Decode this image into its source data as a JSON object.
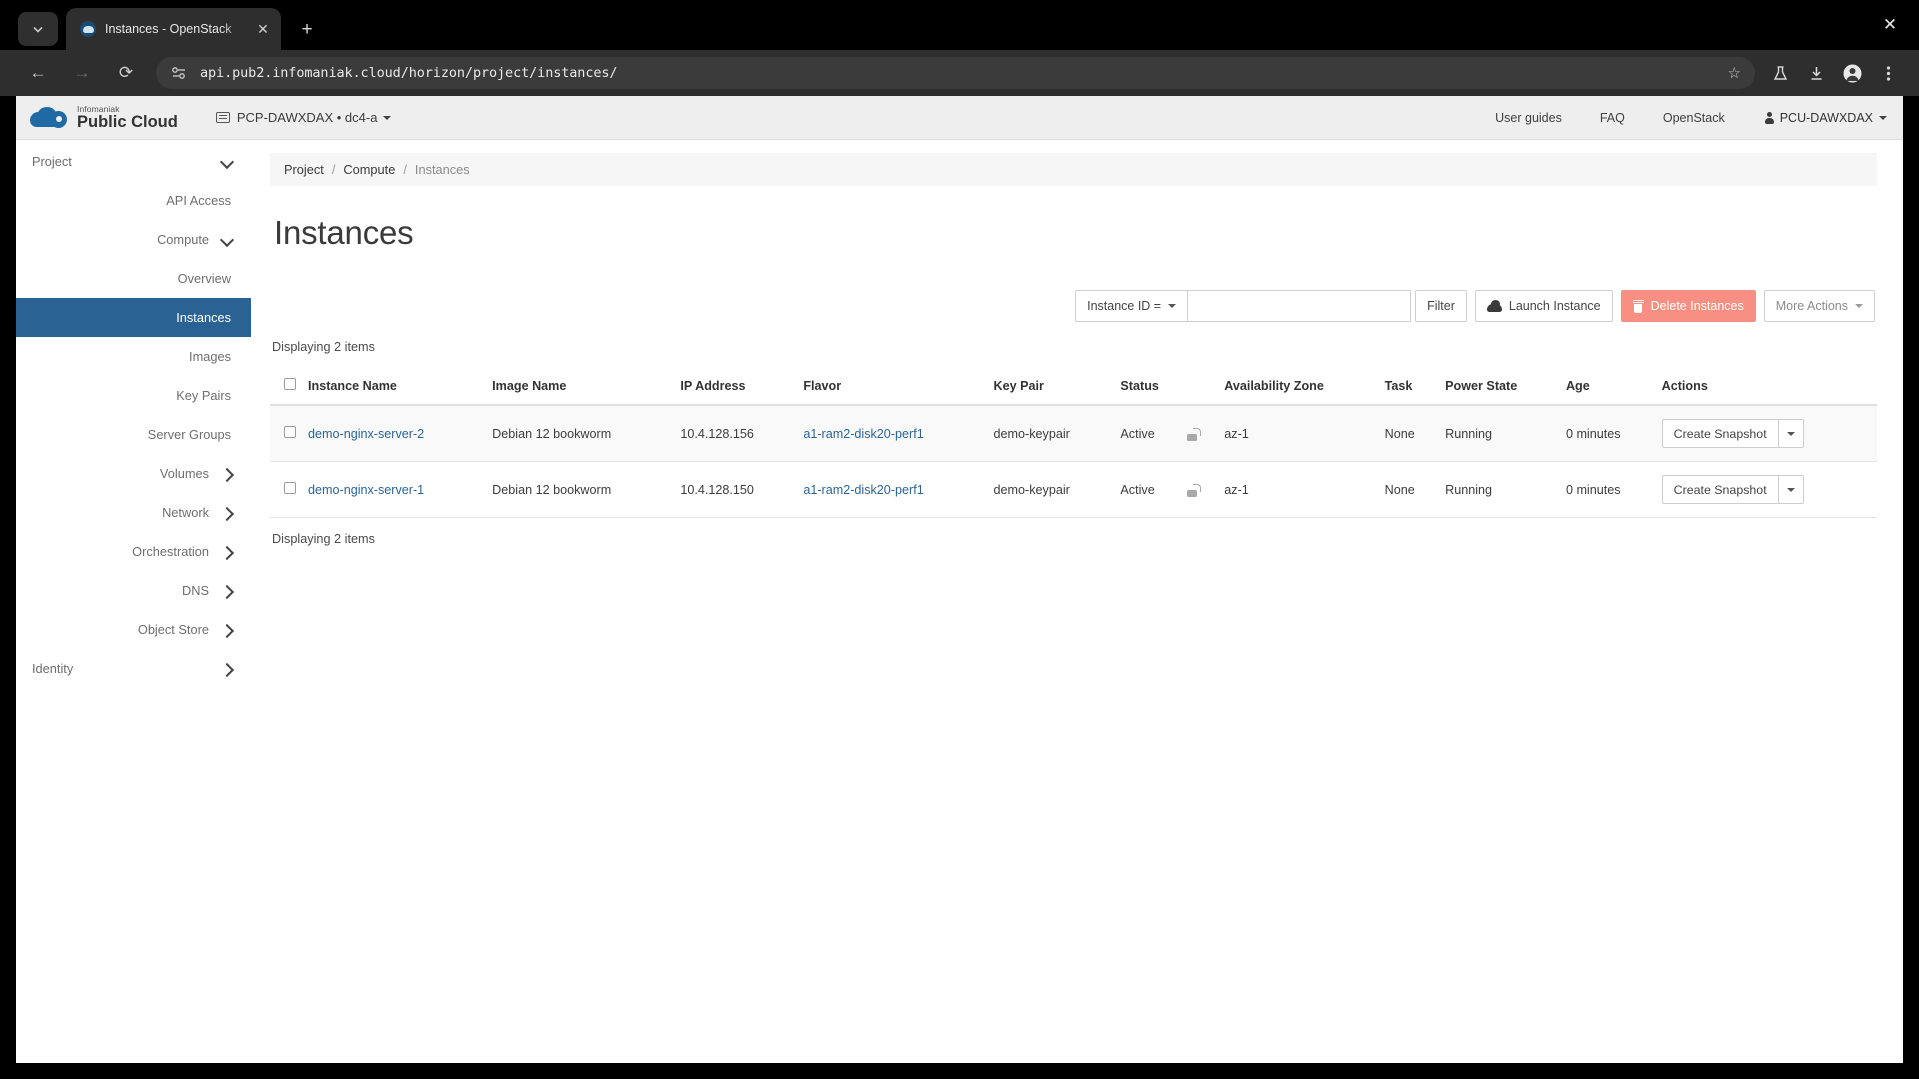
{
  "browser": {
    "tab": {
      "title": "Instances - OpenStack",
      "favicon": "openstack-favicon"
    },
    "new_tab_label": "+",
    "window_close_label": "✕",
    "tab_close_label": "✕",
    "tab_list_label": "⌄",
    "nav": {
      "back": "←",
      "forward": "→",
      "reload": "⟳"
    },
    "url": "api.pub2.infomaniak.cloud/horizon/project/instances/",
    "toolbar_icons": [
      "bookmark-star-icon",
      "experiments-flask-icon",
      "downloads-icon",
      "profile-icon",
      "browser-menu-icon"
    ]
  },
  "header": {
    "brand": {
      "sup": "Infomaniak",
      "main": "Public Cloud"
    },
    "project_switcher": "PCP-DAWXDAX • dc4-a",
    "links": [
      "User guides",
      "FAQ",
      "OpenStack"
    ],
    "user": "PCU-DAWXDAX"
  },
  "sidebar": {
    "items": [
      {
        "label": "Project",
        "level": 0,
        "state": "expanded",
        "active": false
      },
      {
        "label": "API Access",
        "level": 1,
        "state": "leaf",
        "active": false
      },
      {
        "label": "Compute",
        "level": 1,
        "state": "expanded",
        "active": false
      },
      {
        "label": "Overview",
        "level": 2,
        "state": "leaf",
        "active": false
      },
      {
        "label": "Instances",
        "level": 2,
        "state": "leaf",
        "active": true
      },
      {
        "label": "Images",
        "level": 2,
        "state": "leaf",
        "active": false
      },
      {
        "label": "Key Pairs",
        "level": 2,
        "state": "leaf",
        "active": false
      },
      {
        "label": "Server Groups",
        "level": 2,
        "state": "leaf",
        "active": false
      },
      {
        "label": "Volumes",
        "level": 1,
        "state": "collapsed",
        "active": false
      },
      {
        "label": "Network",
        "level": 1,
        "state": "collapsed",
        "active": false
      },
      {
        "label": "Orchestration",
        "level": 1,
        "state": "collapsed",
        "active": false
      },
      {
        "label": "DNS",
        "level": 1,
        "state": "collapsed",
        "active": false
      },
      {
        "label": "Object Store",
        "level": 1,
        "state": "collapsed",
        "active": false
      },
      {
        "label": "Identity",
        "level": 0,
        "state": "collapsed",
        "active": false
      }
    ]
  },
  "breadcrumb": {
    "items": [
      "Project",
      "Compute"
    ],
    "current": "Instances",
    "separator": "/"
  },
  "page": {
    "title": "Instances",
    "count_top": "Displaying 2 items",
    "count_bottom": "Displaying 2 items"
  },
  "toolbar": {
    "filter_field": "Instance ID =",
    "filter_value": "",
    "filter_placeholder": "",
    "filter_button": "Filter",
    "launch_button": "Launch Instance",
    "delete_button": "Delete Instances",
    "more_actions": "More Actions"
  },
  "table": {
    "columns": [
      "Instance Name",
      "Image Name",
      "IP Address",
      "Flavor",
      "Key Pair",
      "Status",
      "Availability Zone",
      "Task",
      "Power State",
      "Age",
      "Actions"
    ],
    "rows": [
      {
        "name": "demo-nginx-server-2",
        "image": "Debian 12 bookworm",
        "ip": "10.4.128.156",
        "flavor": "a1-ram2-disk20-perf1",
        "keypair": "demo-keypair",
        "status": "Active",
        "lock": "unlocked",
        "zone": "az-1",
        "task": "None",
        "power": "Running",
        "age": "0 minutes",
        "action": "Create Snapshot"
      },
      {
        "name": "demo-nginx-server-1",
        "image": "Debian 12 bookworm",
        "ip": "10.4.128.150",
        "flavor": "a1-ram2-disk20-perf1",
        "keypair": "demo-keypair",
        "status": "Active",
        "lock": "unlocked",
        "zone": "az-1",
        "task": "None",
        "power": "Running",
        "age": "0 minutes",
        "action": "Create Snapshot"
      }
    ]
  },
  "colors": {
    "sidebar_active": "#2a6393",
    "link": "#2a6496",
    "danger": "#f79083",
    "header_bg": "#eeeeee"
  }
}
